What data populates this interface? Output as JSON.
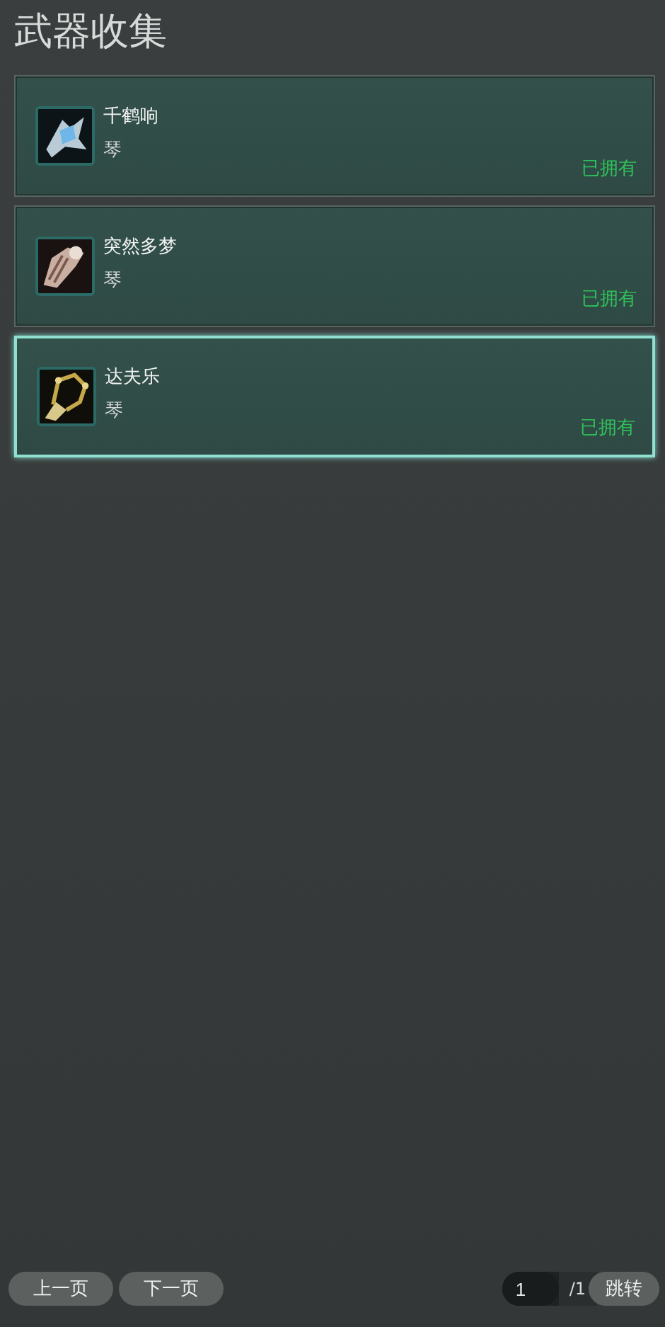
{
  "title": "武器收集",
  "items": [
    {
      "name": "千鹤响",
      "type": "琴",
      "status": "已拥有",
      "selected": false
    },
    {
      "name": "突然多梦",
      "type": "琴",
      "status": "已拥有",
      "selected": false
    },
    {
      "name": "达夫乐",
      "type": "琴",
      "status": "已拥有",
      "selected": true
    }
  ],
  "pager": {
    "prev": "上一页",
    "next": "下一页",
    "page": "1",
    "total": "/1",
    "jump": "跳转"
  }
}
